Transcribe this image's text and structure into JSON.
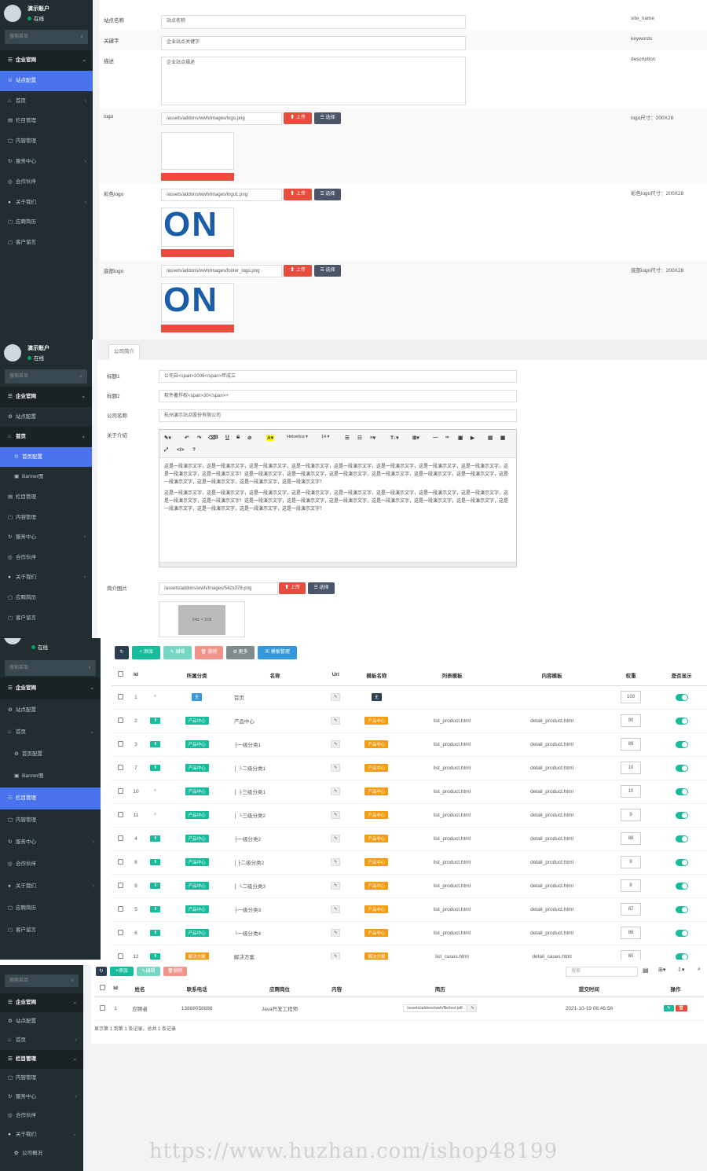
{
  "p1": {
    "user": {
      "name": "演示账户",
      "status": "在线"
    },
    "search_placeholder": "搜索菜单",
    "menu": [
      {
        "label": "企业官网",
        "icon": "☰",
        "type": "hd"
      },
      {
        "label": "站点配置",
        "icon": "⚙",
        "type": "act"
      },
      {
        "label": "首页",
        "icon": "⌂",
        "type": "",
        "arrow": "‹"
      },
      {
        "label": "栏目管理",
        "icon": "▤",
        "type": ""
      },
      {
        "label": "内容管理",
        "icon": "▢",
        "type": ""
      },
      {
        "label": "服务中心",
        "icon": "↻",
        "type": "",
        "arrow": "‹"
      },
      {
        "label": "合作伙伴",
        "icon": "◎",
        "type": ""
      },
      {
        "label": "关于我们",
        "icon": "●",
        "type": "",
        "arrow": "‹"
      },
      {
        "label": "应聘简历",
        "icon": "▢",
        "type": ""
      },
      {
        "label": "客户留言",
        "icon": "▢",
        "type": ""
      }
    ],
    "fields": {
      "site_name": {
        "label": "站点名称",
        "value": "站点名称",
        "tip": "site_name"
      },
      "keywords": {
        "label": "关键字",
        "value": "企业站点关键字",
        "tip": "keywords"
      },
      "desc": {
        "label": "描述",
        "value": "企业站点描述",
        "tip": "description"
      },
      "logo": {
        "label": "logo",
        "value": "/assets/addons/wwh/images/logo.png",
        "tip": "logo尺寸：200X28"
      },
      "color_logo": {
        "label": "彩色logo",
        "value": "/assets/addons/wwh/images/logo1.png",
        "tip": "彩色logo尺寸：200X28"
      },
      "footer_logo": {
        "label": "底部logo",
        "value": "/assets/addons/wwh/images/footer_logo.png",
        "tip": "底部logo尺寸：200X28"
      }
    },
    "upload": "上传",
    "choose": "选择",
    "logo_text": "ON"
  },
  "p2": {
    "user": {
      "name": "演示账户",
      "status": "在线"
    },
    "search_placeholder": "搜索菜单",
    "menu": [
      {
        "label": "企业官网",
        "icon": "☰",
        "type": "hd"
      },
      {
        "label": "站点配置",
        "icon": "⚙",
        "type": ""
      },
      {
        "label": "首页",
        "icon": "⌂",
        "type": "hd2"
      },
      {
        "label": "首页配置",
        "icon": "⚙",
        "type": "act sub"
      },
      {
        "label": "Banner图",
        "icon": "▣",
        "type": "sub"
      },
      {
        "label": "栏目管理",
        "icon": "▤",
        "type": ""
      },
      {
        "label": "内容管理",
        "icon": "▢",
        "type": ""
      },
      {
        "label": "服务中心",
        "icon": "↻",
        "type": "",
        "arrow": "‹"
      },
      {
        "label": "合作伙伴",
        "icon": "◎",
        "type": ""
      },
      {
        "label": "关于我们",
        "icon": "●",
        "type": "",
        "arrow": "‹"
      },
      {
        "label": "应聘简历",
        "icon": "▢",
        "type": ""
      },
      {
        "label": "客户留言",
        "icon": "▢",
        "type": ""
      }
    ],
    "tab": "公司简介",
    "title1": {
      "label": "标题1",
      "value": "公司自<span>2006</span>年成立"
    },
    "title2": {
      "label": "标题2",
      "value": "软件著作权<span>30</span>+"
    },
    "company": {
      "label": "公司名称",
      "value": "杭州演示站点股份有限公司"
    },
    "about_label": "关于介绍",
    "font": "Helvetica",
    "size": "14",
    "para1": "这是一段演示文字，这是一段演示文字，这是一段演示文字，这是一段演示文字，这是一段演示文字，这是一段演示文字，这是一段演示文字，这是一段演示文字，这是一段演示文字，这是一段演示文字！这是一段演示文字，这是一段演示文字，这是一段演示文字，这是一段演示文字，这是一段演示文字，这是一段演示文字，这是一段演示文字，这是一段演示文字，这是一段演示文字，这是一段演示文字！",
    "para2": "这是一段演示文字，这是一段演示文字，这是一段演示文字，这是一段演示文字，这是一段演示文字，这是一段演示文字，这是一段演示文字，这是一段演示文字，这是一段演示文字，这是一段演示文字！这是一段演示文字，这是一段演示文字，这是一段演示文字，这是一段演示文字，这是一段演示文字，这是一段演示文字，这是一段演示文字，这是一段演示文字，这是一段演示文字，这是一段演示文字！",
    "intro_img": {
      "label": "简介图片",
      "value": "/assets/addons/wwh/images/542x378.png",
      "placeholder": "542 × 378"
    },
    "upload": "上传",
    "choose": "选择"
  },
  "p3": {
    "status": "在线",
    "search_placeholder": "搜索菜单",
    "menu": [
      {
        "label": "企业官网",
        "icon": "☰",
        "type": "hd"
      },
      {
        "label": "站点配置",
        "icon": "⚙",
        "type": ""
      },
      {
        "label": "首页",
        "icon": "⌂",
        "type": "",
        "arrow": "⌄"
      },
      {
        "label": "首页配置",
        "icon": "⚙",
        "type": "sub"
      },
      {
        "label": "Banner图",
        "icon": "▣",
        "type": "sub"
      },
      {
        "label": "栏目管理",
        "icon": "☰",
        "type": "act"
      },
      {
        "label": "内容管理",
        "icon": "▢",
        "type": ""
      },
      {
        "label": "服务中心",
        "icon": "↻",
        "type": "",
        "arrow": "‹"
      },
      {
        "label": "合作伙伴",
        "icon": "◎",
        "type": ""
      },
      {
        "label": "关于我们",
        "icon": "●",
        "type": "",
        "arrow": "‹"
      },
      {
        "label": "应聘简历",
        "icon": "▢",
        "type": ""
      },
      {
        "label": "客户留言",
        "icon": "▢",
        "type": ""
      }
    ],
    "toolbar": {
      "add": "添加",
      "edit": "编辑",
      "del": "删除",
      "more": "更多",
      "tpl": "模板管理"
    },
    "headers": [
      "Id",
      "",
      "所属分类",
      "名称",
      "Url",
      "模板名称",
      "列表模板",
      "内容模板",
      "权重",
      "是否显示"
    ],
    "rows": [
      {
        "id": "1",
        "cat": "无",
        "cat_c": "tb",
        "name": "首页",
        "tpl": "无",
        "tpl_c": "td",
        "list": "",
        "content": "",
        "w": "100"
      },
      {
        "id": "2",
        "cat": "产品中心",
        "cat_c": "tg",
        "name": "产品中心",
        "tpl": "产品中心",
        "tpl_c": "to",
        "list": "list_product.html",
        "content": "detail_product.html",
        "w": "90"
      },
      {
        "id": "3",
        "cat": "产品中心",
        "cat_c": "tg",
        "name": "├一级分类1",
        "tpl": "产品中心",
        "tpl_c": "to",
        "list": "list_product.html",
        "content": "detail_product.html",
        "w": "89"
      },
      {
        "id": "7",
        "cat": "产品中心",
        "cat_c": "tg",
        "name": "│ └二级分类1",
        "tpl": "产品中心",
        "tpl_c": "to",
        "list": "list_product.html",
        "content": "detail_product.html",
        "w": "10"
      },
      {
        "id": "10",
        "cat": "产品中心",
        "cat_c": "tg",
        "name": "│ ├三级分类1",
        "tpl": "产品中心",
        "tpl_c": "to",
        "list": "list_product.html",
        "content": "detail_product.html",
        "w": "10"
      },
      {
        "id": "11",
        "cat": "产品中心",
        "cat_c": "tg",
        "name": "│ └三级分类2",
        "tpl": "产品中心",
        "tpl_c": "to",
        "list": "list_product.html",
        "content": "detail_product.html",
        "w": "9"
      },
      {
        "id": "4",
        "cat": "产品中心",
        "cat_c": "tg",
        "name": "├一级分类2",
        "tpl": "产品中心",
        "tpl_c": "to",
        "list": "list_product.html",
        "content": "detail_product.html",
        "w": "88"
      },
      {
        "id": "8",
        "cat": "产品中心",
        "cat_c": "tg",
        "name": "│├二级分类2",
        "tpl": "产品中心",
        "tpl_c": "to",
        "list": "list_product.html",
        "content": "detail_product.html",
        "w": "9"
      },
      {
        "id": "9",
        "cat": "产品中心",
        "cat_c": "tg",
        "name": "│ └二级分类3",
        "tpl": "产品中心",
        "tpl_c": "to",
        "list": "list_product.html",
        "content": "detail_product.html",
        "w": "8"
      },
      {
        "id": "5",
        "cat": "产品中心",
        "cat_c": "tg",
        "name": "├一级分类3",
        "tpl": "产品中心",
        "tpl_c": "to",
        "list": "list_product.html",
        "content": "detail_product.html",
        "w": "87"
      },
      {
        "id": "6",
        "cat": "产品中心",
        "cat_c": "tg",
        "name": "└一级分类4",
        "tpl": "产品中心",
        "tpl_c": "to",
        "list": "list_product.html",
        "content": "detail_product.html",
        "w": "86"
      },
      {
        "id": "12",
        "cat": "解决方案",
        "cat_c": "to",
        "name": "解决方案",
        "tpl": "解决方案",
        "tpl_c": "to",
        "list": "list_cases.html",
        "content": "detail_cases.html",
        "w": "80"
      }
    ]
  },
  "p4": {
    "search_placeholder": "搜索菜单",
    "menu": [
      {
        "label": "企业官网",
        "icon": "☰",
        "type": "hd"
      },
      {
        "label": "站点配置",
        "icon": "⚙",
        "type": ""
      },
      {
        "label": "首页",
        "icon": "⌂",
        "type": "",
        "arrow": "‹"
      },
      {
        "label": "栏目管理",
        "icon": "☰",
        "type": "hd"
      },
      {
        "label": "内容管理",
        "icon": "▢",
        "type": ""
      },
      {
        "label": "服务中心",
        "icon": "↻",
        "type": "",
        "arrow": "‹"
      },
      {
        "label": "合作伙伴",
        "icon": "◎",
        "type": ""
      },
      {
        "label": "关于我们",
        "icon": "●",
        "type": "",
        "arrow": "⌄"
      },
      {
        "label": "公司概况",
        "icon": "✿",
        "type": "sub"
      }
    ],
    "toolbar": {
      "add": "添加",
      "edit": "编辑",
      "del": "删除",
      "search": "搜索"
    },
    "headers": [
      "Id",
      "姓名",
      "联系电话",
      "应聘岗位",
      "内容",
      "简历",
      "提交时间",
      "操作"
    ],
    "row": {
      "id": "1",
      "name": "应聘者",
      "phone": "13888058888",
      "job": "Java开发工程师",
      "content": "",
      "resume": "/assets/addons/wwh/file/test.pdf",
      "time": "2021-10-19 08:46:56"
    },
    "footer": "显示第 1 到第 1 条记录，总共 1 条记录"
  },
  "watermark": "https://www.huzhan.com/ishop48199"
}
